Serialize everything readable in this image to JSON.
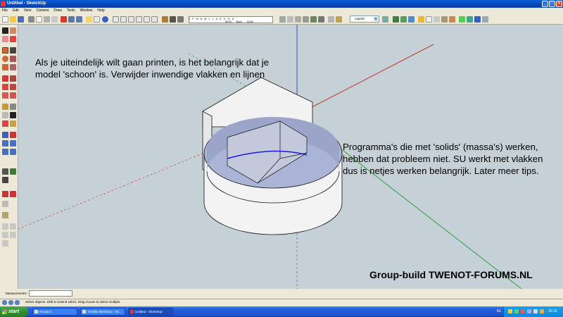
{
  "window": {
    "title": "Untitled - SketchUp"
  },
  "menu": [
    "File",
    "Edit",
    "View",
    "Camera",
    "Draw",
    "Tools",
    "Window",
    "Help"
  ],
  "shadows": {
    "months": "J F M A M J J A S O N D",
    "time_start": "06:43",
    "time_noon": "Noon",
    "time_end": "04:46"
  },
  "layer": {
    "current": "Layer0"
  },
  "notes": {
    "left": "Als je uiteindelijk wilt gaan printen, is het belangrijk dat je model 'schoon' is. Verwijder inwendige vlakken en lijnen",
    "right": "Programma's die met 'solids' (massa's) werken, hebben dat probleem niet. SU werkt met vlakken dus is netjes werken belangrijk. Later meer tips."
  },
  "watermark": "Group-build TWENOT-FORUMS.NL",
  "measurements": {
    "label": "Measurements"
  },
  "status": {
    "text": "Select objects. Shift to extend select. Drag mouse to select multiple."
  },
  "taskbar": {
    "start_label": "start",
    "tasks": [
      "Picasa 3",
      "Trimble SketchUp - Wi...",
      "Untitled - SketchUp"
    ],
    "lang": "NL",
    "clock": "10:16"
  },
  "colors": {
    "viewport_bg": "#c5d1d6",
    "axis_red": "#c0392b",
    "axis_green": "#2e9e3c",
    "axis_blue": "#3a4fd0",
    "edge_selected": "#1a1ae6",
    "inner_face": "#a9b4d6",
    "taskbar": "#245edb"
  }
}
